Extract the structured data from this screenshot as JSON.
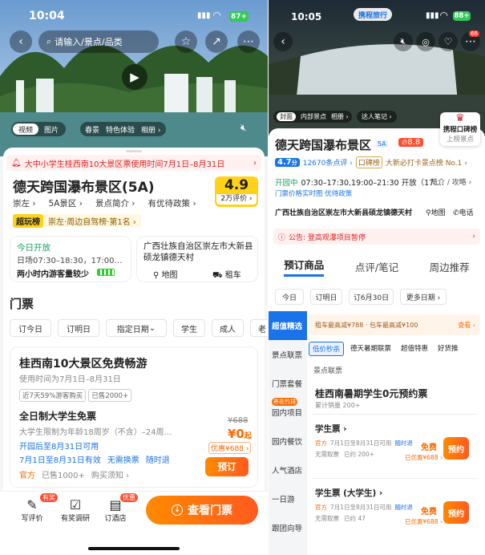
{
  "left": {
    "status": {
      "time": "10:04",
      "battery": "87+"
    },
    "search": {
      "placeholder": "请输入/景点/品类"
    },
    "media_tabs": [
      "视频",
      "图片"
    ],
    "media_tags": [
      "春景",
      "特色体验",
      "相册 ›"
    ],
    "notice": "大中小学生桂西南10大景区票使用时间7月1日–8月31日",
    "title": "德天跨国瀑布景区(5A)",
    "score": "4.9",
    "reviews": "2万评价 ›",
    "meta": [
      "崇左 ›",
      "5A景区 ›",
      "景点简介 ›",
      "有优待政策 ›"
    ],
    "rank_badge": "超玩榜",
    "rank_text": "崇左·周边自驾榜·第1名 ›",
    "open_status": "今日开放",
    "hours": "日场07:30–18:30，17:00…",
    "crowd": "两小时内游客量较少",
    "address": "广西壮族自治区崇左市大新县硕龙镇德天村",
    "map": "地图",
    "car": "租车",
    "section_tickets": "门票",
    "date_filters": [
      "订今日",
      "订明日",
      "指定日期",
      "学生",
      "成人",
      "老"
    ],
    "promo": {
      "title": "桂西南10大景区免费畅游",
      "subtitle": "使用时间为7月1日–8月31日",
      "tags": [
        "近7天59%游客购买",
        "已售2000+"
      ]
    },
    "ticket": {
      "name": "全日制大学生免票",
      "desc": "大学生限制为年龄18周岁（不含）–24周…",
      "open": "开园后至8月31日可用",
      "valid": "7月1日至8月31日有效",
      "nochange": "无需换票",
      "refund": "随时退",
      "official": "官方",
      "sold": "已售1000+",
      "notice": "购买须知 ›",
      "orig_price": "¥688",
      "price": "¥0",
      "price_suffix": "起",
      "discount": "优惠¥688 ›",
      "book": "预订"
    },
    "bottom": {
      "review": "写评价",
      "review_badge": "有奖",
      "survey": "有奖调研",
      "hotel": "订酒店",
      "hotel_badge": "优惠",
      "cta": "查看门票"
    }
  },
  "right": {
    "status": {
      "time": "10:05",
      "app": "携程旅行",
      "battery": "88+"
    },
    "cart_badge": "66",
    "media": [
      "封面",
      "内部景点",
      "相册 ›"
    ],
    "live": "达人笔记 ›",
    "award": {
      "line1": "携程口碑榜",
      "line2": "上榜景点"
    },
    "title": "德天跨国瀑布景区",
    "level": "5A",
    "heat": "8.8",
    "score": "4.7",
    "score_unit": "分",
    "reviews": "12670条点评 ›",
    "rank": "口碑榜",
    "rank_text": "大新必打卡景点榜 No.1 ›",
    "open": "开园中",
    "hours": "07:30–17:30,19:00–21:30 开放（17:…",
    "intro": "简介 / 攻略 ›",
    "policy": "门票价格实时图  优待政策",
    "address": "广西壮族自治区崇左市大新县硕龙镇德天村",
    "map": "地图",
    "phone": "电话",
    "alert": "公告: 登高观瀑项目暂停",
    "tabs": [
      "预订商品",
      "点评/笔记",
      "周边推荐"
    ],
    "dates": [
      "今日",
      "订明日",
      "订6月30日",
      "更多日期 ›"
    ],
    "side": [
      "超值精选",
      "景点联票",
      "门票套餐",
      "园内项目",
      "园内餐饮",
      "人气酒店",
      "一日游",
      "跟团向导"
    ],
    "side_badge": "养花竹排",
    "rent": "租车最高减¥788 · 包车最高减¥100",
    "rent_link": "查看 ›",
    "filters": [
      "低价秒杀",
      "德天暑期联票",
      "超值特惠",
      "好货推"
    ],
    "section": "景点联票",
    "package": {
      "title": "桂西南暑期学生0元预约票",
      "sold": "累计销量 200+"
    },
    "items": [
      {
        "name": "学生票 ›",
        "official": "官方",
        "date": "7月1日至8月31日可用",
        "refund": "随时退",
        "nochange": "无需取票",
        "sold": "已约 200+",
        "free": "免费",
        "saved": "已优惠¥688 ›",
        "btn": "预约"
      },
      {
        "name": "学生票 (大学生) ›",
        "official": "官方",
        "date": "7月1日至8月31日可用",
        "refund": "随时退",
        "nochange": "无需取票",
        "sold": "已约 47",
        "free": "免费",
        "saved": "已优惠¥688 ›",
        "btn": "预约"
      }
    ]
  },
  "colors": {
    "accent": "#ff6a00",
    "blue": "#1a73e8",
    "yellow": "#ffd21a"
  }
}
